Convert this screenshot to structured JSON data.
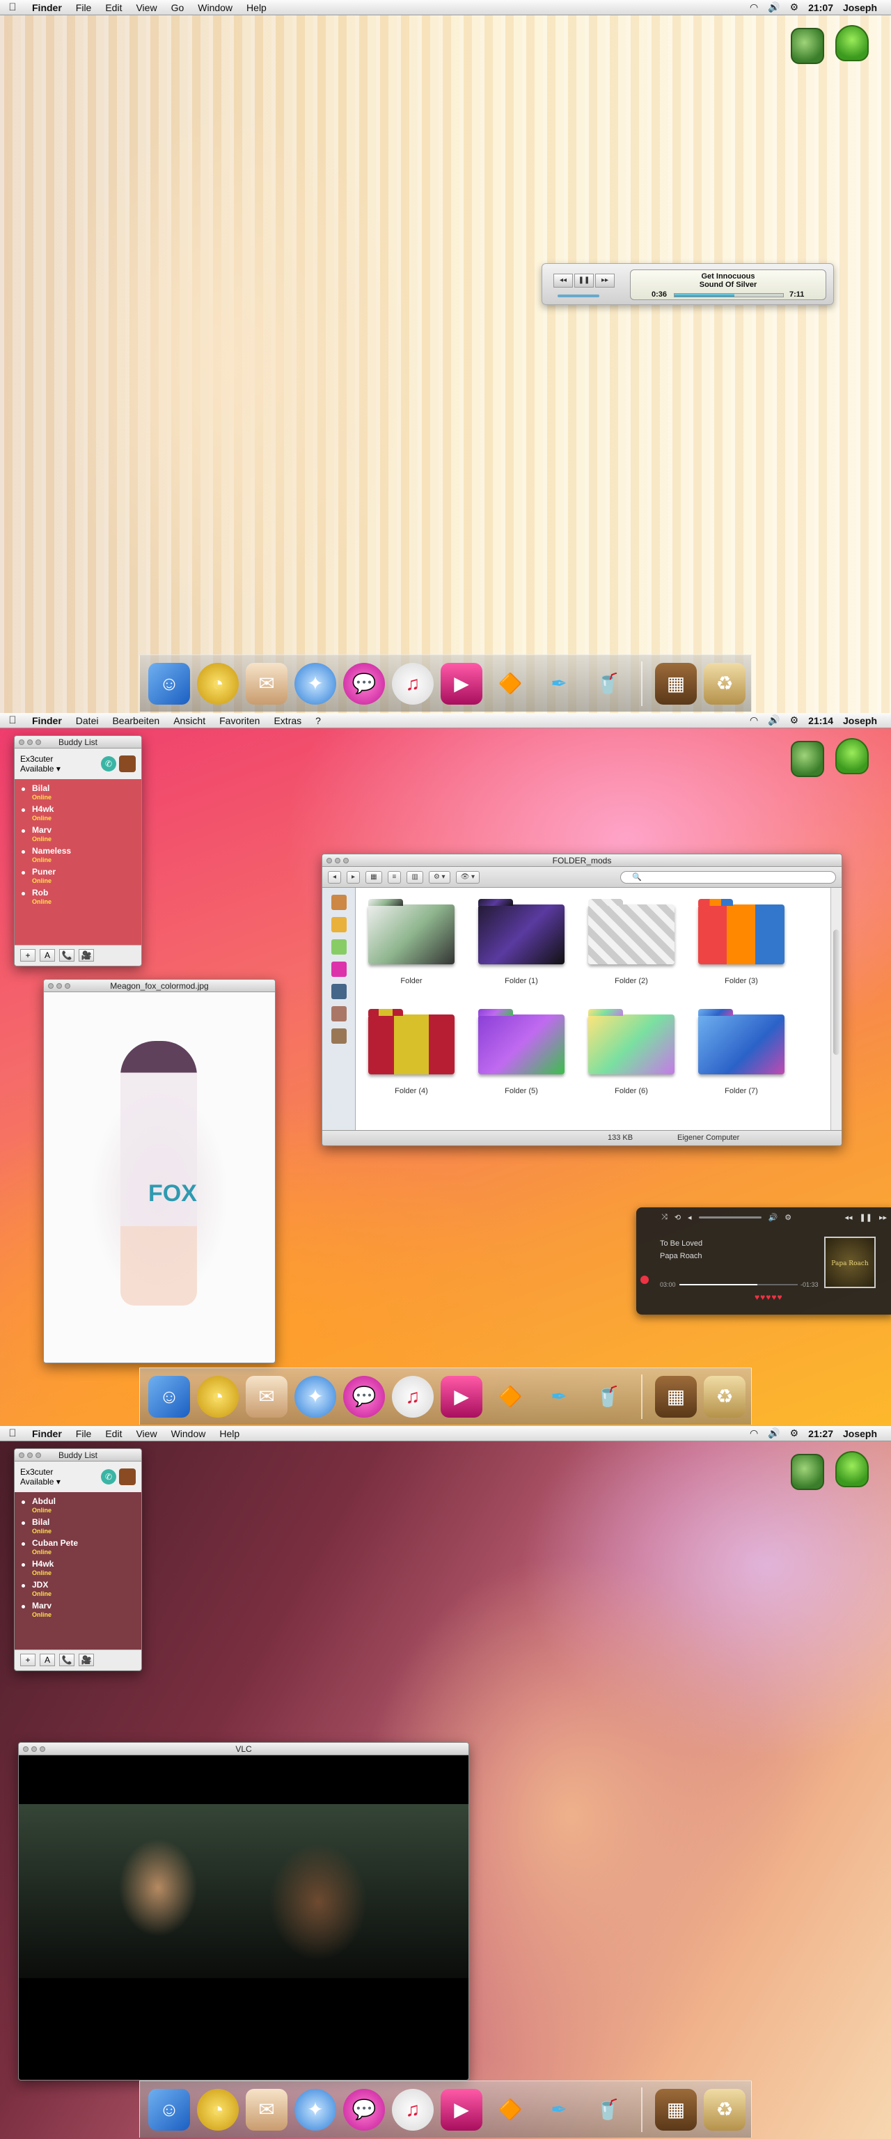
{
  "screens": [
    {
      "menubar": {
        "items": [
          "Finder",
          "File",
          "Edit",
          "View",
          "Go",
          "Window",
          "Help"
        ],
        "time": "21:07",
        "user": "Joseph"
      }
    },
    {
      "menubar": {
        "items": [
          "Finder",
          "Datei",
          "Bearbeiten",
          "Ansicht",
          "Favoriten",
          "Extras",
          "?"
        ],
        "time": "21:14",
        "user": "Joseph"
      }
    },
    {
      "menubar": {
        "items": [
          "Finder",
          "File",
          "Edit",
          "View",
          "Window",
          "Help"
        ],
        "time": "21:27",
        "user": "Joseph"
      }
    }
  ],
  "mini_player": {
    "line1": "Get Innocuous",
    "line2": "Sound Of Silver",
    "elapsed": "0:36",
    "remaining": "7:11",
    "progress": 0.55
  },
  "buddy_list": {
    "title": "Buddy List",
    "account": "Ex3cuter",
    "status": "Available ▾",
    "status_text": "Online",
    "buddies_screen2": [
      "Bilal",
      "H4wk",
      "Marv",
      "Nameless",
      "Puner",
      "Rob"
    ],
    "buddies_screen3": [
      "Abdul",
      "Bilal",
      "Cuban Pete",
      "H4wk",
      "JDX",
      "Marv"
    ],
    "footer_buttons": [
      "+",
      "A",
      "📞",
      "🎥"
    ]
  },
  "image_preview": {
    "title": "Meagon_fox_colormod.jpg",
    "overlay_text": "FOX"
  },
  "folder_window": {
    "title": "FOLDER_mods",
    "nav": [
      "◂",
      "▸"
    ],
    "view": [
      "▦",
      "≡",
      "▥"
    ],
    "action": "⚙ ▾",
    "action2": "👁 ▾",
    "folders": [
      "Folder",
      "Folder (1)",
      "Folder (2)",
      "Folder (3)",
      "Folder (4)",
      "Folder (5)",
      "Folder (6)",
      "Folder (7)"
    ],
    "size": "133 KB",
    "computer": "Eigener Computer"
  },
  "music_widget": {
    "track": "To Be Loved",
    "artist": "Papa Roach",
    "elapsed": "03:00",
    "remaining": "-01:33",
    "rating_hearts": "♥♥♥♥♥",
    "progress": 0.66,
    "album_text": "Papa Roach"
  },
  "vlc": {
    "title": "VLC"
  },
  "colors": {
    "buddy_bg": "#d3505a",
    "online": "#ffe04a"
  }
}
